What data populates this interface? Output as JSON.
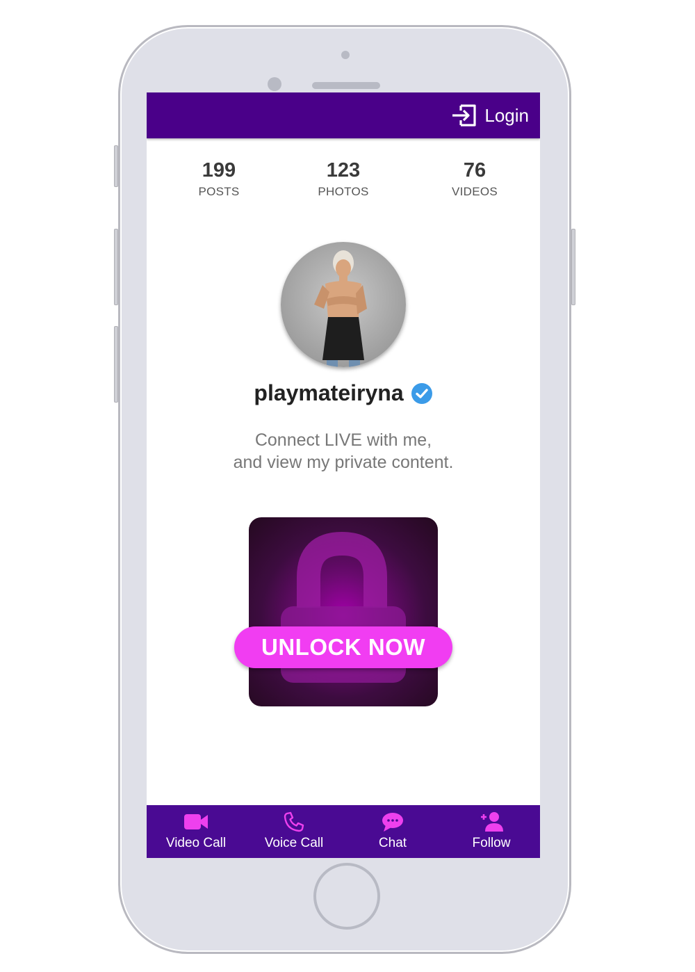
{
  "header": {
    "login_label": "Login"
  },
  "stats": [
    {
      "count": "199",
      "label": "POSTS"
    },
    {
      "count": "123",
      "label": "PHOTOS"
    },
    {
      "count": "76",
      "label": "VIDEOS"
    }
  ],
  "profile": {
    "username": "playmateiryna",
    "tagline_line1": "Connect LIVE with me,",
    "tagline_line2": "and view my private content."
  },
  "unlock": {
    "label": "UNLOCK NOW"
  },
  "bottom_nav": [
    {
      "label": "Video Call",
      "icon": "video-camera-icon"
    },
    {
      "label": "Voice Call",
      "icon": "phone-icon"
    },
    {
      "label": "Chat",
      "icon": "chat-bubble-icon"
    },
    {
      "label": "Follow",
      "icon": "add-user-icon"
    }
  ],
  "colors": {
    "header": "#4a0089",
    "accent_pink": "#f13df2",
    "bottom_nav": "#4a0a93",
    "verified_badge": "#3b9be8"
  }
}
